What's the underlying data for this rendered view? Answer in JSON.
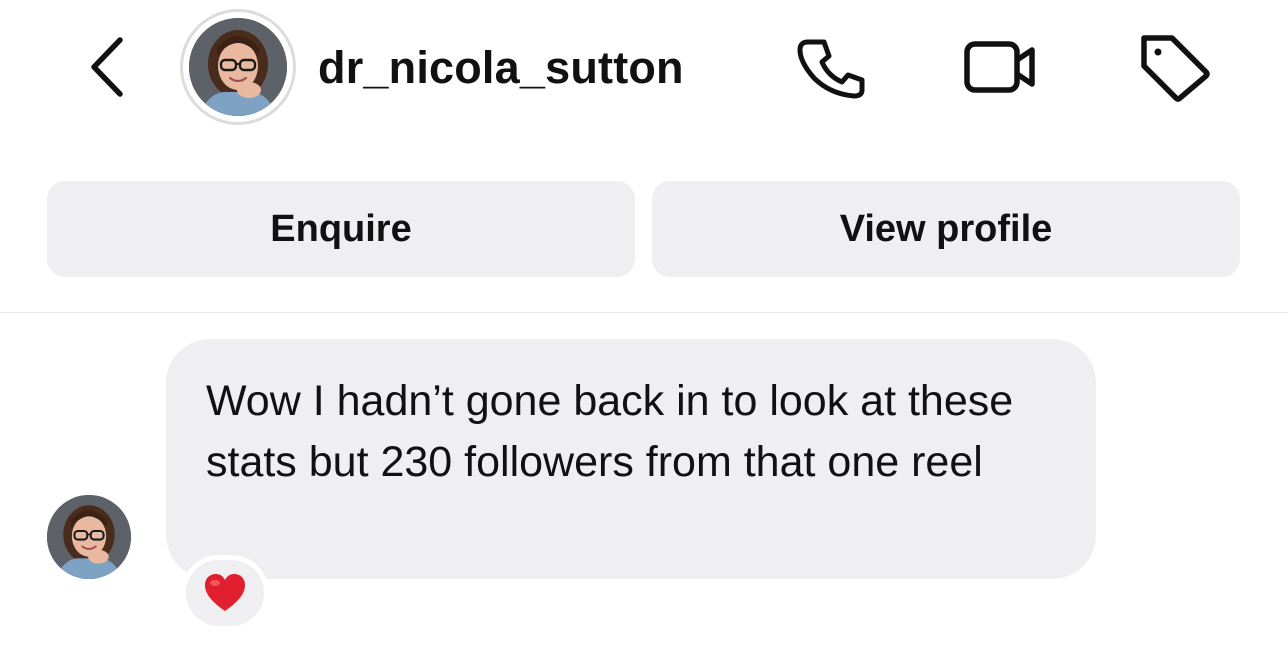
{
  "header": {
    "back_icon": "chevron-left-icon",
    "username": "dr_nicola_sutton",
    "avatar_icon": "profile-photo",
    "actions": [
      "phone-icon",
      "video-camera-icon",
      "tag-icon"
    ]
  },
  "buttons": {
    "enquire_label": "Enquire",
    "view_profile_label": "View profile"
  },
  "message": {
    "text": "Wow I hadn’t gone back in to look at these stats but 230 followers from that one reel",
    "reaction_icon": "red-heart-emoji"
  },
  "colors": {
    "bubble_bg": "#efeff2",
    "button_bg": "#efeff2",
    "heart": "#e0202e"
  }
}
